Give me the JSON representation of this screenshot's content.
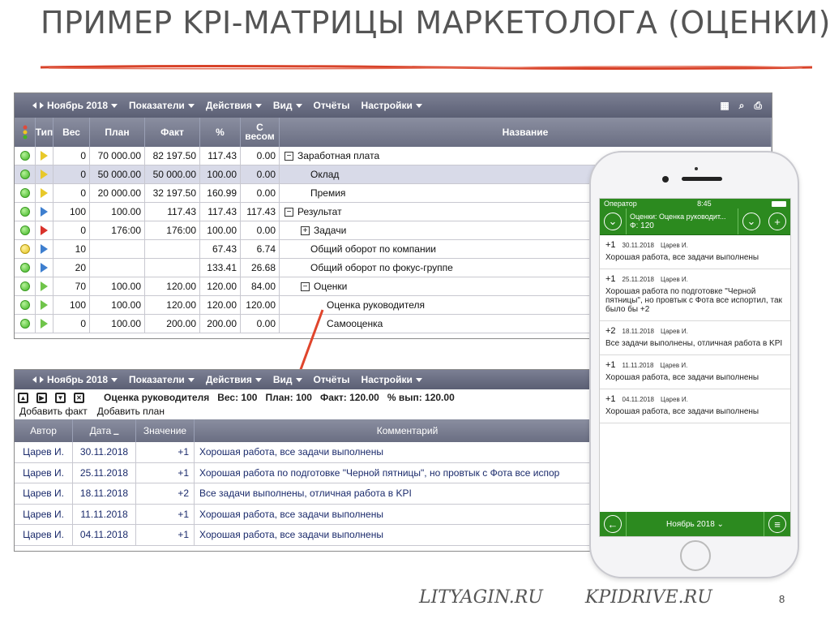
{
  "slide": {
    "title": "ПРИМЕР KPI-МАТРИЦЫ МАРКЕТОЛОГА (ОЦЕНКИ)",
    "page_number": "8",
    "footer_sites": [
      "LITYAGIN.RU",
      "KPIDRIVE.RU"
    ]
  },
  "colors": {
    "underline": "#d8432a",
    "toolbar": "#6a6e82",
    "phone_green": "#2c8a1f"
  },
  "window1": {
    "toolbar": {
      "period": "Ноябрь 2018",
      "menus": [
        "Показатели",
        "Действия",
        "Вид",
        "Отчёты",
        "Настройки"
      ],
      "icons": [
        "grid-icon",
        "search-icon",
        "print-icon"
      ]
    },
    "headers": {
      "type": "Тип",
      "weight": "Вес",
      "plan": "План",
      "fact": "Факт",
      "pct": "%",
      "with_weight": "С весом",
      "name": "Название"
    },
    "rows": [
      {
        "ind": "green",
        "flag": "yellow",
        "weight": "0",
        "plan": "70 000.00",
        "fact": "82 197.50",
        "pct": "117.43",
        "ws": "0.00",
        "name": "Заработная плата",
        "level": 0,
        "tree": "minus"
      },
      {
        "ind": "green",
        "flag": "yellow",
        "weight": "0",
        "plan": "50 000.00",
        "fact": "50 000.00",
        "pct": "100.00",
        "ws": "0.00",
        "name": "Оклад",
        "level": 1,
        "tree": "",
        "selected": true
      },
      {
        "ind": "green",
        "flag": "yellow",
        "weight": "0",
        "plan": "20 000.00",
        "fact": "32 197.50",
        "pct": "160.99",
        "ws": "0.00",
        "name": "Премия",
        "level": 1,
        "tree": ""
      },
      {
        "ind": "green",
        "flag": "blue",
        "weight": "100",
        "plan": "100.00",
        "fact": "117.43",
        "pct": "117.43",
        "ws": "117.43",
        "name": "Результат",
        "level": 0,
        "tree": "minus"
      },
      {
        "ind": "green",
        "flag": "red",
        "weight": "0",
        "plan": "176:00",
        "fact": "176:00",
        "pct": "100.00",
        "ws": "0.00",
        "name": "Задачи",
        "level": 1,
        "tree": "plus"
      },
      {
        "ind": "yellow",
        "flag": "blue",
        "weight": "10",
        "plan": "",
        "fact": "",
        "pct": "67.43",
        "ws": "6.74",
        "name": "Общий оборот по компании",
        "level": 1,
        "tree": ""
      },
      {
        "ind": "green",
        "flag": "blue",
        "weight": "20",
        "plan": "",
        "fact": "",
        "pct": "133.41",
        "ws": "26.68",
        "name": "Общий оборот по фокус-группе",
        "level": 1,
        "tree": ""
      },
      {
        "ind": "green",
        "flag": "green",
        "weight": "70",
        "plan": "100.00",
        "fact": "120.00",
        "pct": "120.00",
        "ws": "84.00",
        "name": "Оценки",
        "level": 1,
        "tree": "minus"
      },
      {
        "ind": "green",
        "flag": "green",
        "weight": "100",
        "plan": "100.00",
        "fact": "120.00",
        "pct": "120.00",
        "ws": "120.00",
        "name": "Оценка руководителя",
        "level": 2,
        "tree": ""
      },
      {
        "ind": "green",
        "flag": "green",
        "weight": "0",
        "plan": "100.00",
        "fact": "200.00",
        "pct": "200.00",
        "ws": "0.00",
        "name": "Самооценка",
        "level": 2,
        "tree": ""
      }
    ]
  },
  "window2": {
    "toolbar": {
      "period": "Ноябрь 2018",
      "menus": [
        "Показатели",
        "Действия",
        "Вид",
        "Отчёты",
        "Настройки"
      ]
    },
    "info": {
      "title": "Оценка руководителя",
      "weight": "Вес: 100",
      "plan": "План: 100",
      "fact": "Факт: 120.00",
      "pct": "% вып: 120.00"
    },
    "actions": {
      "add_fact": "Добавить факт",
      "add_plan": "Добавить план"
    },
    "headers": {
      "author": "Автор",
      "date": "Дата",
      "value": "Значение",
      "comment": "Комментарий"
    },
    "rows": [
      {
        "author": "Царев И.",
        "date": "30.11.2018",
        "value": "+1",
        "comment": "Хорошая работа, все задачи выполнены"
      },
      {
        "author": "Царев И.",
        "date": "25.11.2018",
        "value": "+1",
        "comment": "Хорошая работа по подготовке \"Черной пятницы\", но провтык с Фота все испор"
      },
      {
        "author": "Царев И.",
        "date": "18.11.2018",
        "value": "+2",
        "comment": "Все задачи выполнены, отличная работа в KPI"
      },
      {
        "author": "Царев И.",
        "date": "11.11.2018",
        "value": "+1",
        "comment": "Хорошая работа, все задачи выполнены"
      },
      {
        "author": "Царев И.",
        "date": "04.11.2018",
        "value": "+1",
        "comment": "Хорошая работа, все задачи выполнены"
      }
    ]
  },
  "phone": {
    "status": {
      "operator": "Оператор",
      "time": "8:45"
    },
    "header": {
      "title": "Оценки: Оценка руководит...",
      "fact": "Ф: 120"
    },
    "items": [
      {
        "val": "+1",
        "date": "30.11.2018",
        "author": "Царев И.",
        "text": "Хорошая работа, все задачи выполнены"
      },
      {
        "val": "+1",
        "date": "25.11.2018",
        "author": "Царев И.",
        "text": "Хорошая работа по подготовке \"Черной пятницы\", но провтык с Фота все испортил, так было бы +2"
      },
      {
        "val": "+2",
        "date": "18.11.2018",
        "author": "Царев И.",
        "text": "Все задачи выполнены, отличная работа в KPI"
      },
      {
        "val": "+1",
        "date": "11.11.2018",
        "author": "Царев И.",
        "text": "Хорошая работа, все задачи выполнены"
      },
      {
        "val": "+1",
        "date": "04.11.2018",
        "author": "Царев И.",
        "text": "Хорошая работа, все задачи выполнены"
      }
    ],
    "footer": {
      "period": "Ноябрь 2018"
    }
  }
}
